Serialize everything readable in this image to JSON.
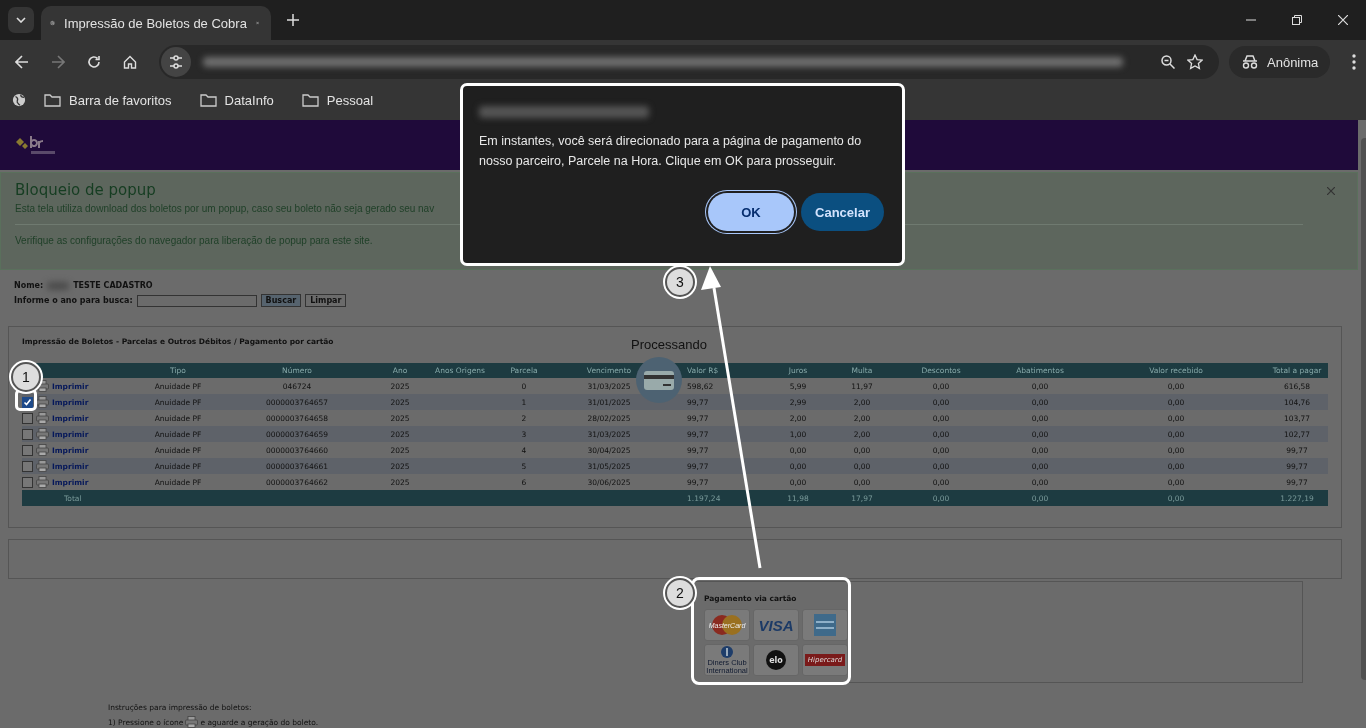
{
  "browser": {
    "tab_title": "Impressão de Boletos de Cobra",
    "profile": "Anônima",
    "bookmarks": [
      "Barra de favoritos",
      "DataInfo",
      "Pessoal"
    ]
  },
  "notice": {
    "title": "Bloqueio de popup",
    "text": "Esta tela utiliza download dos boletos por um popup, caso seu boleto não seja gerado seu nav",
    "hint": "Verifique as configurações do navegador para liberação de popup para este site."
  },
  "person": {
    "label": "Nome:",
    "value": "TESTE CADASTRO"
  },
  "search": {
    "label": "Informe o ano para busca:",
    "buttons": [
      "Buscar",
      "Limpar"
    ]
  },
  "panel": {
    "title": "Impressão de Boletos - Parcelas e Outros Débitos / Pagamento por cartão",
    "status": "Processando"
  },
  "table": {
    "columns": [
      "Tipo",
      "Número",
      "Ano",
      "Anos Origens",
      "Parcela",
      "Vencimento",
      "Valor R$",
      "Juros",
      "Multa",
      "Descontos",
      "Abatimentos",
      "Valor recebido",
      "Total a pagar"
    ],
    "rows": [
      {
        "link": "Imprimir",
        "cells": [
          "Anuidade PF",
          "046724",
          "2025",
          null,
          "0",
          "31/03/2025",
          "598,62",
          "5,99",
          "11,97",
          "0,00",
          "0,00",
          "0,00",
          "616,58"
        ]
      },
      {
        "checked": true,
        "link": "Imprimir",
        "cells": [
          "Anuidade PF",
          "0000003764657",
          "2025",
          null,
          "1",
          "31/01/2025",
          "99,77",
          "2,99",
          "2,00",
          "0,00",
          "0,00",
          "0,00",
          "104,76"
        ]
      },
      {
        "checked": false,
        "link": "Imprimir",
        "cells": [
          "Anuidade PF",
          "0000003764658",
          "2025",
          null,
          "2",
          "28/02/2025",
          "99,77",
          "2,00",
          "2,00",
          "0,00",
          "0,00",
          "0,00",
          "103,77"
        ]
      },
      {
        "checked": false,
        "link": "Imprimir",
        "cells": [
          "Anuidade PF",
          "0000003764659",
          "2025",
          null,
          "3",
          "31/03/2025",
          "99,77",
          "1,00",
          "2,00",
          "0,00",
          "0,00",
          "0,00",
          "102,77"
        ]
      },
      {
        "checked": false,
        "link": "Imprimir",
        "cells": [
          "Anuidade PF",
          "0000003764660",
          "2025",
          null,
          "4",
          "30/04/2025",
          "99,77",
          "0,00",
          "0,00",
          "0,00",
          "0,00",
          "0,00",
          "99,77"
        ]
      },
      {
        "checked": false,
        "link": "Imprimir",
        "cells": [
          "Anuidade PF",
          "0000003764661",
          "2025",
          null,
          "5",
          "31/05/2025",
          "99,77",
          "0,00",
          "0,00",
          "0,00",
          "0,00",
          "0,00",
          "99,77"
        ]
      },
      {
        "checked": false,
        "link": "Imprimir",
        "cells": [
          "Anuidade PF",
          "0000003764662",
          "2025",
          null,
          "6",
          "30/06/2025",
          "99,77",
          "0,00",
          "0,00",
          "0,00",
          "0,00",
          "0,00",
          "99,77"
        ]
      }
    ],
    "total": {
      "label": "Total",
      "cells": [
        null,
        null,
        null,
        null,
        null,
        null,
        "1.197,24",
        "11,98",
        "17,97",
        "0,00",
        "0,00",
        "0,00",
        "1.227,19"
      ]
    }
  },
  "payment": {
    "title": "Pagamento via cartão",
    "cards": [
      {
        "kind": "mastercard",
        "label": "MasterCard"
      },
      {
        "kind": "visa",
        "label": "VISA"
      },
      {
        "kind": "amex"
      },
      {
        "kind": "diners",
        "label": "Diners Club International"
      },
      {
        "kind": "elo",
        "label": "elo"
      },
      {
        "kind": "hipercard",
        "label": "Hipercard"
      }
    ]
  },
  "instructions": {
    "title": "Instruções para impressão de boletos:",
    "step_before": "1) Pressione o ícone",
    "step_after": "e aguarde a geração do boleto."
  },
  "dialog": {
    "message": "Em instantes, você será direcionado para a página de pagamento do nosso parceiro, Parcele na Hora. Clique em OK para prosseguir.",
    "buttons": [
      {
        "label": "OK",
        "kind": "primary"
      },
      {
        "label": "Cancelar",
        "kind": "secondary"
      }
    ]
  },
  "annotations": [
    "1",
    "2",
    "3"
  ]
}
